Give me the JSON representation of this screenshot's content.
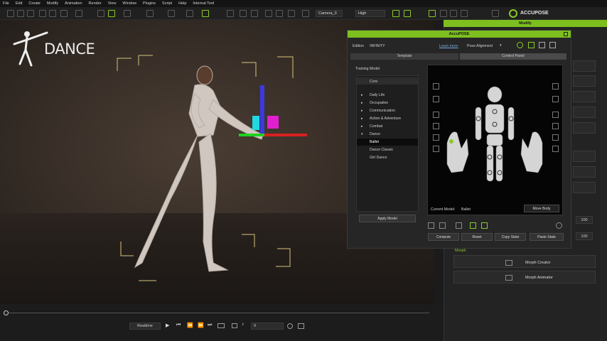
{
  "menu": [
    "File",
    "Edit",
    "Create",
    "Modify",
    "Animation",
    "Render",
    "View",
    "Window",
    "Plugins",
    "Script",
    "Help",
    "Internal Tool"
  ],
  "toolbar": {
    "camera": "Camera_0",
    "quality": "High",
    "brand": "ACCUPOSE"
  },
  "overlay": {
    "title": "DANCE"
  },
  "right_panel": {
    "header": "Modify",
    "values": [
      "100",
      "100"
    ],
    "morph_header": "Morph",
    "morph_creator": "Morph Creator",
    "morph_animator": "Morph Animator"
  },
  "accupose": {
    "title": "AccuPOSE",
    "edition_label": "Edition",
    "edition_value": "INFINITY",
    "learn_more": "Learn more",
    "pose_alignment": "Pose Alignment",
    "tabs": [
      "Template",
      "Control Panel"
    ],
    "training_model": "Training Model",
    "tree": [
      "Core",
      "Daily Life",
      "Occupation",
      "Communication",
      "Action & Adventure",
      "Combat",
      "Dance",
      "Ballet",
      "Dance Classic",
      "Girl Dance"
    ],
    "apply_model": "Apply Model",
    "current_model_label": "Current Model:",
    "current_model": "Ballet",
    "move_body": "Move Body",
    "buttons": [
      "Compute",
      "Reset",
      "Copy State",
      "Paste State"
    ]
  },
  "timeline": {
    "mode": "Realtime",
    "frame": "0"
  }
}
